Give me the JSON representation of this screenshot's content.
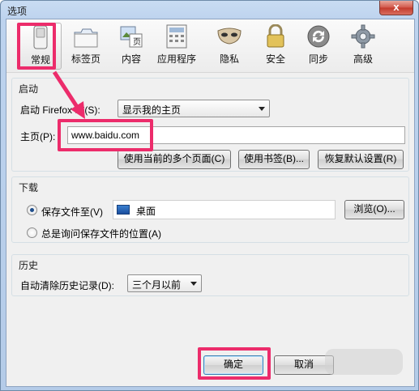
{
  "window": {
    "title": "选项",
    "close_glyph": "x"
  },
  "toolbar": {
    "items": [
      {
        "label": "常规",
        "icon": "switch-icon"
      },
      {
        "label": "标签页",
        "icon": "tabs-icon"
      },
      {
        "label": "内容",
        "icon": "content-icon"
      },
      {
        "label": "应用程序",
        "icon": "applications-icon"
      },
      {
        "label": "隐私",
        "icon": "mask-icon"
      },
      {
        "label": "安全",
        "icon": "lock-icon"
      },
      {
        "label": "同步",
        "icon": "sync-icon"
      },
      {
        "label": "高级",
        "icon": "gear-icon"
      }
    ]
  },
  "startup": {
    "title": "启动",
    "when_label": "启动 Firefox 时(S):",
    "when_value": "显示我的主页",
    "homepage_label": "主页(P):",
    "homepage_value": "www.baidu.com",
    "buttons": [
      "使用当前的多个页面(C)",
      "使用书签(B)...",
      "恢复默认设置(R)"
    ]
  },
  "downloads": {
    "title": "下载",
    "save_to_label": "保存文件至(V)",
    "save_to_value": "桌面",
    "browse_button": "浏览(O)...",
    "ask_label": "总是询问保存文件的位置(A)"
  },
  "history": {
    "title": "历史",
    "clear_label": "自动清除历史记录(D):",
    "clear_value": "三个月以前"
  },
  "footer": {
    "ok": "确定",
    "cancel": "取消"
  },
  "colors": {
    "highlight": "#ec2c6b",
    "window_frame": "#bdd3ee"
  }
}
